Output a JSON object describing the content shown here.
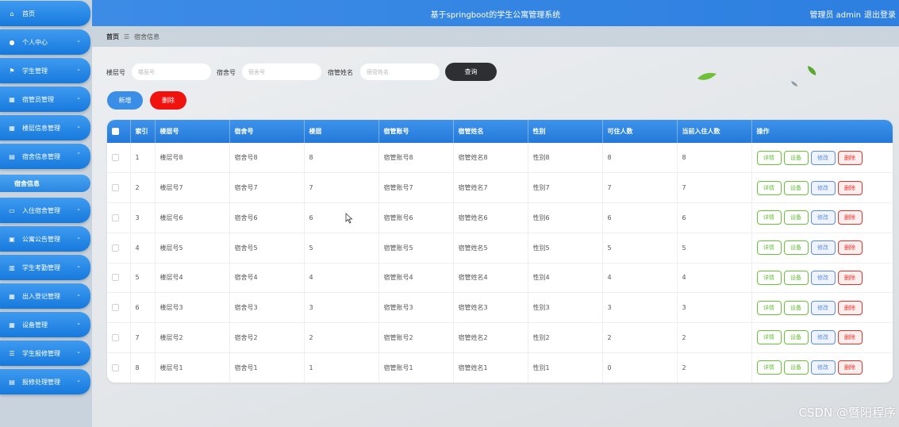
{
  "sidebar": {
    "items": [
      {
        "label": "首页",
        "icon": "home-icon",
        "chevron": ""
      },
      {
        "label": "个人中心",
        "icon": "user-icon",
        "chevron": "⌄"
      },
      {
        "label": "学生管理",
        "icon": "flag-icon",
        "chevron": "⌄"
      },
      {
        "label": "宿管员管理",
        "icon": "grid-icon",
        "chevron": "⌄"
      },
      {
        "label": "楼层信息管理",
        "icon": "grid-icon",
        "chevron": "⌄"
      },
      {
        "label": "宿舍信息管理",
        "icon": "clipboard-icon",
        "chevron": "⌃"
      },
      {
        "label": "入住宿舍管理",
        "icon": "monitor-icon",
        "chevron": "⌄"
      },
      {
        "label": "公寓公告管理",
        "icon": "briefcase-icon",
        "chevron": "⌄"
      },
      {
        "label": "学生考勤管理",
        "icon": "chart-icon",
        "chevron": "⌄"
      },
      {
        "label": "出入登记管理",
        "icon": "grid-icon",
        "chevron": "⌄"
      },
      {
        "label": "设备管理",
        "icon": "grid-icon",
        "chevron": "⌄"
      },
      {
        "label": "学生报修管理",
        "icon": "list-icon",
        "chevron": "⌄"
      },
      {
        "label": "报修处理管理",
        "icon": "clipboard-icon",
        "chevron": "⌄"
      }
    ],
    "submenu": {
      "label": "宿舍信息"
    }
  },
  "header": {
    "title": "基于springboot的学生公寓管理系统",
    "admin": "管理员 admin",
    "logout": "退出登录"
  },
  "breadcrumb": {
    "home": "首页",
    "separator": "☰",
    "current": "宿舍信息"
  },
  "search": {
    "floor_label": "楼层号",
    "floor_placeholder": "楼层号",
    "room_label": "宿舍号",
    "room_placeholder": "宿舍号",
    "manager_label": "宿管姓名",
    "manager_placeholder": "宿管姓名",
    "button": "查询"
  },
  "actions": {
    "add": "新增",
    "delete": "删除"
  },
  "table": {
    "headers": [
      "索引",
      "楼层号",
      "宿舍号",
      "楼层",
      "宿管账号",
      "宿管姓名",
      "性别",
      "可住人数",
      "当前入住人数",
      "操作"
    ],
    "op_labels": {
      "detail": "详情",
      "device": "设备",
      "edit": "修改",
      "delete": "删除"
    },
    "rows": [
      [
        "1",
        "楼层号8",
        "宿舍号8",
        "8",
        "宿管账号8",
        "宿管姓名8",
        "性别8",
        "8",
        "8"
      ],
      [
        "2",
        "楼层号7",
        "宿舍号7",
        "7",
        "宿管账号7",
        "宿管姓名7",
        "性别7",
        "7",
        "7"
      ],
      [
        "3",
        "楼层号6",
        "宿舍号6",
        "6",
        "宿管账号6",
        "宿管姓名6",
        "性别6",
        "6",
        "6"
      ],
      [
        "4",
        "楼层号5",
        "宿舍号5",
        "5",
        "宿管账号5",
        "宿管姓名5",
        "性别5",
        "5",
        "5"
      ],
      [
        "5",
        "楼层号4",
        "宿舍号4",
        "4",
        "宿管账号4",
        "宿管姓名4",
        "性别4",
        "4",
        "4"
      ],
      [
        "6",
        "楼层号3",
        "宿舍号3",
        "3",
        "宿管账号3",
        "宿管姓名3",
        "性别3",
        "3",
        "3"
      ],
      [
        "7",
        "楼层号2",
        "宿舍号2",
        "2",
        "宿管账号2",
        "宿管姓名2",
        "性别2",
        "2",
        "2"
      ],
      [
        "8",
        "楼层号1",
        "宿舍号1",
        "1",
        "宿管账号1",
        "宿管姓名1",
        "性别1",
        "0",
        "2"
      ]
    ]
  },
  "colors": {
    "accent": "#2d7fe0",
    "danger": "#f0120f",
    "success": "#67c23a",
    "dark_button": "#2d2f33"
  },
  "watermark": "CSDN @暨阳程序"
}
